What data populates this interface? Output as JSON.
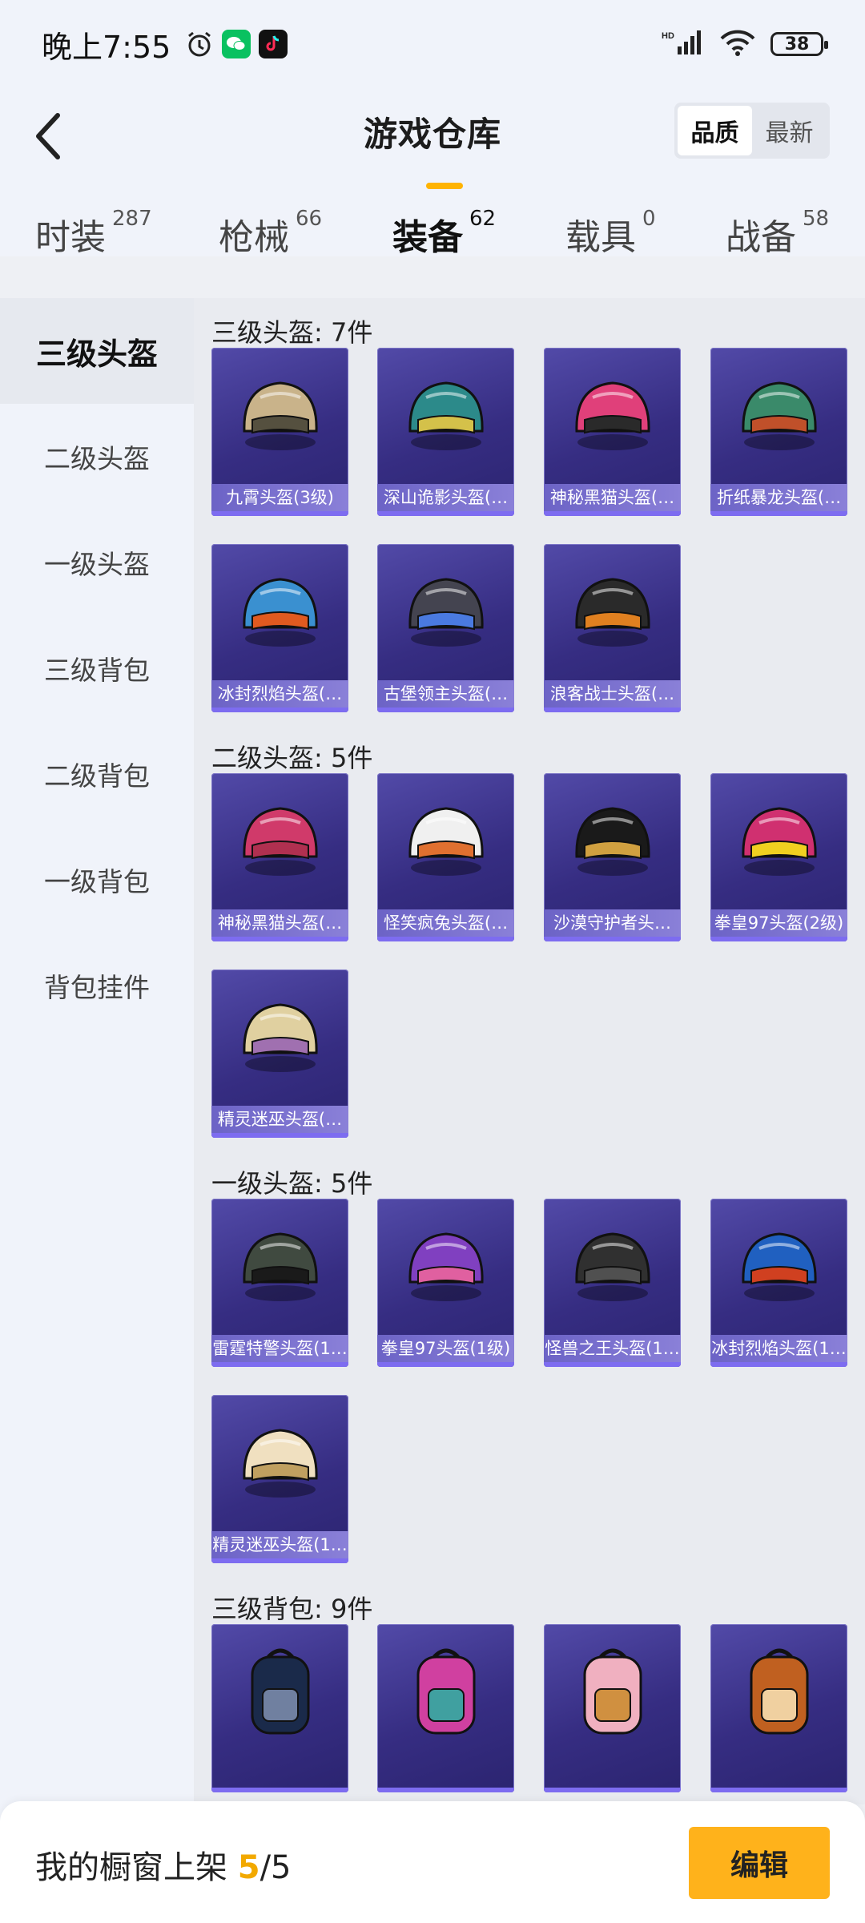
{
  "status": {
    "time": "晚上7:55",
    "battery": "38",
    "network": "HD"
  },
  "header": {
    "title": "游戏仓库",
    "sort_options": [
      "品质",
      "最新"
    ]
  },
  "tabs": [
    {
      "label": "时装",
      "count": "287"
    },
    {
      "label": "枪械",
      "count": "66"
    },
    {
      "label": "装备",
      "count": "62"
    },
    {
      "label": "载具",
      "count": "0"
    },
    {
      "label": "战备",
      "count": "58"
    }
  ],
  "sidebar": [
    "三级头盔",
    "二级头盔",
    "一级头盔",
    "三级背包",
    "二级背包",
    "一级背包",
    "背包挂件"
  ],
  "sections": [
    {
      "title": "三级头盔: 7件",
      "items": [
        "九霄头盔(3级)",
        "深山诡影头盔(…",
        "神秘黑猫头盔(…",
        "折纸暴龙头盔(…",
        "冰封烈焰头盔(…",
        "古堡领主头盔(…",
        "浪客战士头盔(…"
      ]
    },
    {
      "title": "二级头盔: 5件",
      "items": [
        "神秘黑猫头盔(…",
        "怪笑疯兔头盔(…",
        "沙漠守护者头…",
        "拳皇97头盔(2级)",
        "精灵迷巫头盔(…"
      ]
    },
    {
      "title": "一级头盔: 5件",
      "items": [
        "雷霆特警头盔(1…",
        "拳皇97头盔(1级)",
        "怪兽之王头盔(1…",
        "冰封烈焰头盔(1…",
        "精灵迷巫头盔(1…"
      ]
    },
    {
      "title": "三级背包: 9件",
      "items": [
        "",
        "",
        "",
        ""
      ]
    }
  ],
  "footer": {
    "label": "我的橱窗上架",
    "shelf_count": "5",
    "shelf_total": "/5",
    "edit_label": "编辑"
  },
  "colors": {
    "accent": "#ffb21b",
    "card_bg": "#3b3290",
    "label_bg": "#7a70d0"
  }
}
